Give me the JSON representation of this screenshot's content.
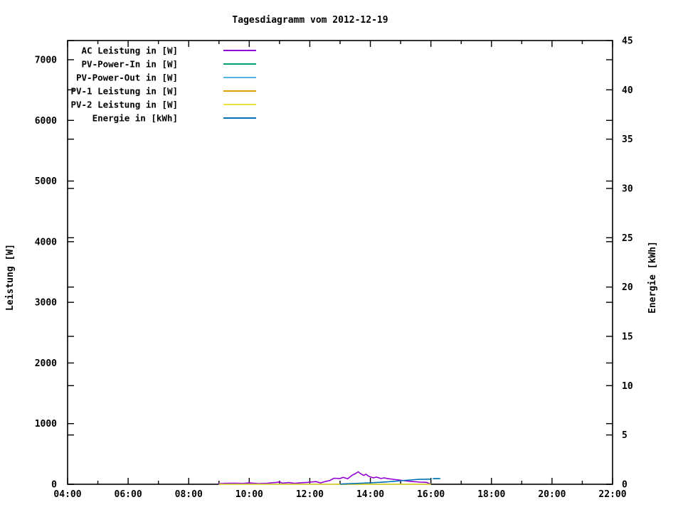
{
  "window": {
    "background": "#ffffff"
  },
  "chart_data": {
    "type": "line",
    "title": "Tagesdiagramm vom 2012-12-19",
    "x_axis": {
      "label": "",
      "unit": "time",
      "range_hours": [
        4,
        22
      ],
      "major_ticks": [
        {
          "h": 4,
          "label": "04:00"
        },
        {
          "h": 6,
          "label": "06:00"
        },
        {
          "h": 8,
          "label": "08:00"
        },
        {
          "h": 10,
          "label": "10:00"
        },
        {
          "h": 12,
          "label": "12:00"
        },
        {
          "h": 14,
          "label": "14:00"
        },
        {
          "h": 16,
          "label": "16:00"
        },
        {
          "h": 18,
          "label": "18:00"
        },
        {
          "h": 20,
          "label": "20:00"
        },
        {
          "h": 22,
          "label": "22:00"
        }
      ],
      "minor_tick_every_hours": 1
    },
    "y_left": {
      "label": "Leistung [W]",
      "range": [
        0,
        7320
      ],
      "tick_values": [
        0,
        1000,
        2000,
        3000,
        4000,
        5000,
        6000,
        7000
      ],
      "tick_labels": [
        "0",
        "1000",
        "2000",
        "3000",
        "4000",
        "5000",
        "6000",
        "7000"
      ]
    },
    "y_right": {
      "label": "Energie [kWh]",
      "range": [
        0,
        45
      ],
      "tick_values": [
        0,
        5,
        10,
        15,
        20,
        25,
        30,
        35,
        40,
        45
      ],
      "tick_labels": [
        "0",
        "5",
        "10",
        "15",
        "20",
        "25",
        "30",
        "35",
        "40",
        "45"
      ]
    },
    "legend_position": "top-left-inside",
    "grid": false,
    "series": [
      {
        "name": "AC Leistung in [W]",
        "color": "#9400d3",
        "axis": "left",
        "segments": [
          [
            [
              8.97,
              8
            ],
            [
              9.2,
              15
            ],
            [
              9.5,
              18
            ],
            [
              9.8,
              14
            ],
            [
              10.0,
              22
            ],
            [
              10.3,
              12
            ],
            [
              10.6,
              18
            ],
            [
              10.9,
              30
            ],
            [
              11.0,
              38
            ],
            [
              11.1,
              18
            ],
            [
              11.3,
              28
            ],
            [
              11.5,
              15
            ],
            [
              11.7,
              25
            ],
            [
              11.9,
              30
            ],
            [
              12.0,
              35
            ],
            [
              12.2,
              45
            ],
            [
              12.35,
              22
            ],
            [
              12.55,
              50
            ],
            [
              12.65,
              60
            ],
            [
              12.8,
              100
            ],
            [
              13.0,
              95
            ],
            [
              13.1,
              115
            ],
            [
              13.25,
              92
            ],
            [
              13.4,
              150
            ],
            [
              13.5,
              175
            ],
            [
              13.6,
              205
            ],
            [
              13.68,
              175
            ],
            [
              13.78,
              145
            ],
            [
              13.85,
              165
            ],
            [
              13.95,
              130
            ],
            [
              14.1,
              105
            ],
            [
              14.2,
              118
            ],
            [
              14.35,
              95
            ],
            [
              14.45,
              105
            ],
            [
              14.6,
              92
            ],
            [
              14.75,
              82
            ],
            [
              14.95,
              70
            ],
            [
              15.15,
              58
            ],
            [
              15.4,
              45
            ],
            [
              15.65,
              35
            ],
            [
              15.85,
              32
            ],
            [
              15.95,
              12
            ],
            [
              16.0,
              0
            ]
          ]
        ]
      },
      {
        "name": "PV-Power-In in [W]",
        "color": "#009e73",
        "axis": "left",
        "segments": [
          [
            [
              9.0,
              0
            ],
            [
              16.0,
              0
            ]
          ]
        ]
      },
      {
        "name": "PV-Power-Out in [W]",
        "color": "#56b4e9",
        "axis": "left",
        "segments": [
          [
            [
              9.0,
              0
            ],
            [
              12.9,
              0
            ]
          ],
          [
            [
              16.05,
              95
            ],
            [
              16.32,
              95
            ]
          ]
        ]
      },
      {
        "name": "PV-1 Leistung in [W]",
        "color": "#e69f00",
        "axis": "left",
        "segments": [
          [
            [
              9.0,
              0
            ],
            [
              16.0,
              0
            ]
          ]
        ]
      },
      {
        "name": "PV-2 Leistung in [W]",
        "color": "#f0e442",
        "axis": "left",
        "segments": [
          [
            [
              9.0,
              0
            ],
            [
              16.0,
              0
            ]
          ]
        ]
      },
      {
        "name": "Energie in [kWh]",
        "color": "#0072b2",
        "axis": "right",
        "segments": [
          [
            [
              13.0,
              0.02
            ],
            [
              13.5,
              0.08
            ],
            [
              14.0,
              0.15
            ],
            [
              14.45,
              0.22
            ],
            [
              14.8,
              0.3
            ],
            [
              15.0,
              0.36
            ],
            [
              15.3,
              0.43
            ],
            [
              15.6,
              0.5
            ],
            [
              16.0,
              0.52
            ]
          ],
          [
            [
              16.08,
              0.56
            ],
            [
              16.3,
              0.58
            ]
          ]
        ]
      }
    ]
  }
}
